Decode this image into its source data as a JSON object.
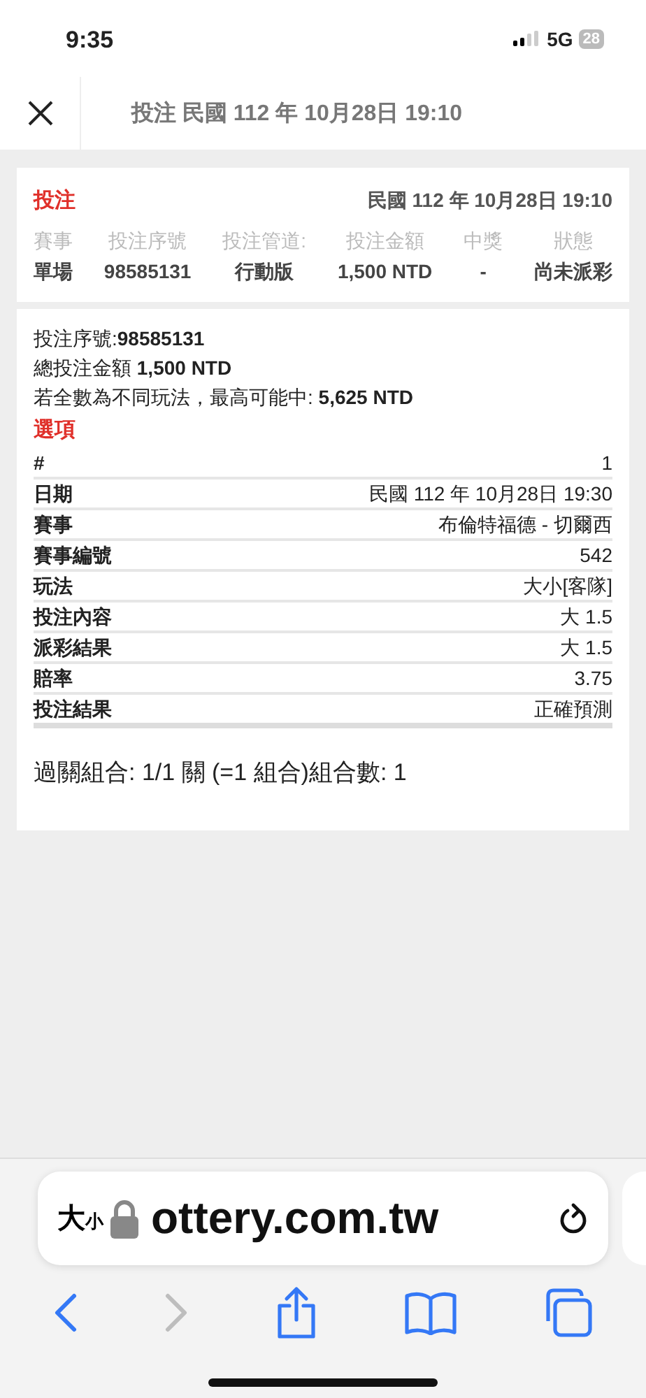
{
  "status_bar": {
    "time": "9:35",
    "network": "5G",
    "battery": "28"
  },
  "header": {
    "title": "投注 民國 112 年 10月28日 19:10"
  },
  "summary": {
    "heading": "投注",
    "date": "民國 112 年 10月28日 19:10",
    "columns": [
      {
        "label": "賽事",
        "value": "單場"
      },
      {
        "label": "投注序號",
        "value": "98585131"
      },
      {
        "label": "投注管道:",
        "value": "行動版"
      },
      {
        "label": "投注金額",
        "value": "1,500 NTD"
      },
      {
        "label": "中獎",
        "value": "-"
      },
      {
        "label": "狀態",
        "value": "尚未派彩"
      }
    ]
  },
  "details": {
    "lines": [
      "投注序號:**98585131**",
      "總投注金額 **1,500 NTD**",
      "若全數為不同玩法，最高可能中: **5,625 NTD**"
    ],
    "section_title": "選項",
    "rows": [
      {
        "label": "#",
        "value": "1"
      },
      {
        "label": "日期",
        "value": "民國 112 年 10月28日 19:30"
      },
      {
        "label": "賽事",
        "value": "布倫特福德 - 切爾西"
      },
      {
        "label": "賽事編號",
        "value": "542"
      },
      {
        "label": "玩法",
        "value": "大小[客隊]"
      },
      {
        "label": "投注內容",
        "value": "大 1.5"
      },
      {
        "label": "派彩結果",
        "value": "大 1.5"
      },
      {
        "label": "賠率",
        "value": "3.75"
      },
      {
        "label": "投注結果",
        "value": "正確預測"
      }
    ],
    "footer": "過關組合: 1/1 關 (=1 組合)組合數: 1"
  },
  "browser": {
    "text_size": "大小",
    "url": "ottery.com.tw",
    "toolbar": [
      {
        "kind": "back",
        "disabled": false
      },
      {
        "kind": "forward",
        "disabled": true
      },
      {
        "kind": "share",
        "disabled": false
      },
      {
        "kind": "bookmarks",
        "disabled": false
      },
      {
        "kind": "tabs",
        "disabled": false
      }
    ]
  }
}
